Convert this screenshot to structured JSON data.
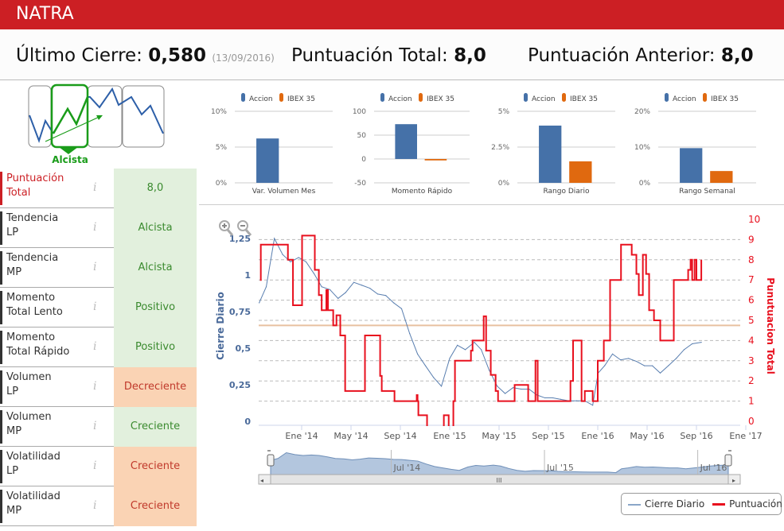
{
  "header": {
    "title": "NATRA"
  },
  "scores": {
    "last_close_label": "Último Cierre:",
    "last_close_value": "0,580",
    "last_close_date": "(13/09/2016)",
    "total_label": "Puntuación Total:",
    "total_value": "8,0",
    "previous_label": "Puntuación Anterior:",
    "previous_value": "8,0"
  },
  "trend_badge": {
    "label": "Alcista",
    "color": "#1a9c1a"
  },
  "indicators": [
    {
      "label1": "Puntuación",
      "label2": "Total",
      "value": "8,0",
      "status": "positive",
      "highlight": true
    },
    {
      "label1": "Tendencia",
      "label2": "LP",
      "value": "Alcista",
      "status": "positive"
    },
    {
      "label1": "Tendencia",
      "label2": "MP",
      "value": "Alcista",
      "status": "positive"
    },
    {
      "label1": "Momento",
      "label2": "Total Lento",
      "value": "Positivo",
      "status": "positive"
    },
    {
      "label1": "Momento",
      "label2": "Total Rápido",
      "value": "Positivo",
      "status": "positive"
    },
    {
      "label1": "Volumen",
      "label2": "LP",
      "value": "Decreciente",
      "status": "negative"
    },
    {
      "label1": "Volumen",
      "label2": "MP",
      "value": "Creciente",
      "status": "positive"
    },
    {
      "label1": "Volatilidad",
      "label2": "LP",
      "value": "Creciente",
      "status": "negative"
    },
    {
      "label1": "Volatilidad",
      "label2": "MP",
      "value": "Creciente",
      "status": "negative"
    }
  ],
  "info_icon": "i",
  "colors": {
    "brand": "#cc1f24",
    "accion": "#4571a8",
    "ibex": "#e0690f",
    "close": "#5a7fb0",
    "score": "#e8101e",
    "threshold": "#e8c1a0"
  },
  "chart_data": [
    {
      "type": "bar",
      "title": "",
      "xlabel": "Var. Volumen Mes",
      "categories": [
        "Accion",
        "IBEX 35"
      ],
      "values": [
        6.2,
        0
      ],
      "ylim": [
        0,
        10
      ],
      "yticks": [
        "10%",
        "5%",
        "0%"
      ],
      "tickvals": [
        10,
        5,
        0
      ],
      "legend": [
        "Accion",
        "IBEX 35"
      ],
      "legend_position": "top"
    },
    {
      "type": "bar",
      "title": "",
      "xlabel": "Momento Rápido",
      "categories": [
        "Accion",
        "IBEX 35"
      ],
      "values": [
        73,
        -3
      ],
      "ylim": [
        -50,
        100
      ],
      "yticks": [
        "100",
        "50",
        "0",
        "-50"
      ],
      "tickvals": [
        100,
        50,
        0,
        -50
      ],
      "legend": [
        "Accion",
        "IBEX 35"
      ],
      "legend_position": "top"
    },
    {
      "type": "bar",
      "title": "",
      "xlabel": "Rango Diario",
      "categories": [
        "Accion",
        "IBEX 35"
      ],
      "values": [
        4.0,
        1.5
      ],
      "ylim": [
        0,
        5
      ],
      "yticks": [
        "5%",
        "2.5%",
        "0%"
      ],
      "tickvals": [
        5,
        2.5,
        0
      ],
      "legend": [
        "Accion",
        "IBEX 35"
      ],
      "legend_position": "top"
    },
    {
      "type": "bar",
      "title": "",
      "xlabel": "Rango Semanal",
      "categories": [
        "Accion",
        "IBEX 35"
      ],
      "values": [
        9.7,
        3.3
      ],
      "ylim": [
        0,
        20
      ],
      "yticks": [
        "20%",
        "10%",
        "0%"
      ],
      "tickvals": [
        20,
        10,
        0
      ],
      "legend": [
        "Accion",
        "IBEX 35"
      ],
      "legend_position": "top"
    },
    {
      "type": "line",
      "ylabel": "Cierre Diario",
      "y2label": "Punutuacion Total",
      "ylim": [
        0,
        1.25
      ],
      "y2lim": [
        0,
        10
      ],
      "grid": true,
      "legend_position": "bottom-right",
      "yticks": [
        "1,25",
        "1",
        "0,75",
        "0,5",
        "0,25",
        "0"
      ],
      "ytickvals": [
        1.25,
        1,
        0.75,
        0.5,
        0.25,
        0
      ],
      "y2ticks": [
        "10",
        "9",
        "8",
        "7",
        "6",
        "5",
        "4",
        "3",
        "2",
        "1",
        "0"
      ],
      "xticks": [
        {
          "label": "Ene '14",
          "date": "2014-01-01"
        },
        {
          "label": "May '14",
          "date": "2014-05-01"
        },
        {
          "label": "Sep '14",
          "date": "2014-09-01"
        },
        {
          "label": "Ene '15",
          "date": "2015-01-01"
        },
        {
          "label": "May '15",
          "date": "2015-05-01"
        },
        {
          "label": "Sep '15",
          "date": "2015-09-01"
        },
        {
          "label": "Ene '16",
          "date": "2016-01-01"
        },
        {
          "label": "May '16",
          "date": "2016-05-01"
        },
        {
          "label": "Sep '16",
          "date": "2016-09-01"
        },
        {
          "label": "Ene '17",
          "date": "2017-01-01"
        }
      ],
      "threshold_y2": 4.75,
      "series": [
        {
          "name": "Cierre Diario",
          "axis": "left",
          "points": [
            [
              "2013-09-18",
              0.81
            ],
            [
              "2013-10-05",
              0.92
            ],
            [
              "2013-10-25",
              1.25
            ],
            [
              "2013-11-15",
              1.14
            ],
            [
              "2013-12-04",
              1.09
            ],
            [
              "2013-12-24",
              1.12
            ],
            [
              "2014-01-12",
              1.09
            ],
            [
              "2014-02-01",
              1.01
            ],
            [
              "2014-02-20",
              0.92
            ],
            [
              "2014-03-10",
              0.9
            ],
            [
              "2014-03-30",
              0.84
            ],
            [
              "2014-04-18",
              0.88
            ],
            [
              "2014-05-08",
              0.95
            ],
            [
              "2014-05-28",
              0.93
            ],
            [
              "2014-06-17",
              0.91
            ],
            [
              "2014-07-06",
              0.87
            ],
            [
              "2014-07-26",
              0.86
            ],
            [
              "2014-08-15",
              0.81
            ],
            [
              "2014-09-04",
              0.77
            ],
            [
              "2014-09-24",
              0.6
            ],
            [
              "2014-10-13",
              0.46
            ],
            [
              "2014-11-02",
              0.38
            ],
            [
              "2014-11-22",
              0.3
            ],
            [
              "2014-12-11",
              0.24
            ],
            [
              "2015-01-01",
              0.43
            ],
            [
              "2015-01-20",
              0.52
            ],
            [
              "2015-02-09",
              0.49
            ],
            [
              "2015-03-01",
              0.54
            ],
            [
              "2015-03-18",
              0.49
            ],
            [
              "2015-04-07",
              0.35
            ],
            [
              "2015-04-27",
              0.24
            ],
            [
              "2015-05-16",
              0.19
            ],
            [
              "2015-06-05",
              0.23
            ],
            [
              "2015-06-25",
              0.22
            ],
            [
              "2015-07-14",
              0.22
            ],
            [
              "2015-08-03",
              0.18
            ],
            [
              "2015-08-23",
              0.16
            ],
            [
              "2015-09-12",
              0.16
            ],
            [
              "2015-10-01",
              0.15
            ],
            [
              "2015-10-21",
              0.14
            ],
            [
              "2015-11-10",
              0.14
            ],
            [
              "2015-11-30",
              0.14
            ],
            [
              "2015-12-19",
              0.11
            ],
            [
              "2016-01-02",
              0.33
            ],
            [
              "2016-01-18",
              0.38
            ],
            [
              "2016-02-07",
              0.46
            ],
            [
              "2016-02-27",
              0.42
            ],
            [
              "2016-03-16",
              0.43
            ],
            [
              "2016-04-05",
              0.41
            ],
            [
              "2016-04-25",
              0.38
            ],
            [
              "2016-05-14",
              0.38
            ],
            [
              "2016-06-03",
              0.33
            ],
            [
              "2016-06-23",
              0.38
            ],
            [
              "2016-07-12",
              0.43
            ],
            [
              "2016-08-01",
              0.49
            ],
            [
              "2016-08-21",
              0.53
            ],
            [
              "2016-09-13",
              0.54
            ]
          ]
        },
        {
          "name": "Puntuación",
          "axis": "right",
          "step": true,
          "points": [
            [
              "2013-09-20",
              7
            ],
            [
              "2013-09-22",
              8.75
            ],
            [
              "2013-11-28",
              8
            ],
            [
              "2013-12-10",
              5.75
            ],
            [
              "2014-01-02",
              9.2
            ],
            [
              "2014-02-03",
              7.5
            ],
            [
              "2014-02-13",
              6.25
            ],
            [
              "2014-02-20",
              5.5
            ],
            [
              "2014-03-01",
              6.5
            ],
            [
              "2014-03-05",
              5.5
            ],
            [
              "2014-03-18",
              4.75
            ],
            [
              "2014-03-26",
              5.25
            ],
            [
              "2014-04-05",
              4.25
            ],
            [
              "2014-04-17",
              1.5
            ],
            [
              "2014-06-05",
              4.25
            ],
            [
              "2014-07-12",
              2.25
            ],
            [
              "2014-07-16",
              1.5
            ],
            [
              "2014-08-17",
              1
            ],
            [
              "2014-10-11",
              1.3
            ],
            [
              "2014-10-13",
              1
            ],
            [
              "2014-10-15",
              0.3
            ],
            [
              "2014-11-06",
              -0.5
            ],
            [
              "2014-12-17",
              0.3
            ],
            [
              "2014-12-29",
              -0.5
            ],
            [
              "2015-01-10",
              1
            ],
            [
              "2015-01-14",
              3
            ],
            [
              "2015-02-23",
              3.5
            ],
            [
              "2015-02-27",
              4
            ],
            [
              "2015-03-24",
              5.2
            ],
            [
              "2015-03-30",
              3.5
            ],
            [
              "2015-04-11",
              2.3
            ],
            [
              "2015-04-23",
              1.5
            ],
            [
              "2015-04-29",
              1
            ],
            [
              "2015-06-09",
              1.8
            ],
            [
              "2015-07-12",
              1
            ],
            [
              "2015-07-30",
              3
            ],
            [
              "2015-08-05",
              1
            ],
            [
              "2015-10-25",
              2
            ],
            [
              "2015-11-01",
              4
            ],
            [
              "2015-11-22",
              1
            ],
            [
              "2015-11-30",
              1.5
            ],
            [
              "2015-12-19",
              1
            ],
            [
              "2016-01-01",
              3
            ],
            [
              "2016-01-16",
              4
            ],
            [
              "2016-02-01",
              7
            ],
            [
              "2016-02-28",
              8.75
            ],
            [
              "2016-03-24",
              8.25
            ],
            [
              "2016-04-05",
              7.3
            ],
            [
              "2016-04-11",
              6.25
            ],
            [
              "2016-04-21",
              8.25
            ],
            [
              "2016-04-29",
              7.3
            ],
            [
              "2016-05-06",
              5.5
            ],
            [
              "2016-05-18",
              5
            ],
            [
              "2016-06-03",
              4
            ],
            [
              "2016-07-06",
              7
            ],
            [
              "2016-08-11",
              7.5
            ],
            [
              "2016-08-17",
              8
            ],
            [
              "2016-08-21",
              7
            ],
            [
              "2016-08-27",
              8
            ],
            [
              "2016-09-01",
              7
            ],
            [
              "2016-09-13",
              8
            ]
          ]
        }
      ]
    }
  ],
  "navigator": {
    "labels": [
      "Jul '14",
      "Jul '15",
      "Jul '16"
    ],
    "label_dates": [
      "2014-07-01",
      "2015-07-01",
      "2016-07-01"
    ],
    "scroll_grip": "III"
  },
  "legend": {
    "items": [
      "Cierre Diario",
      "Puntuación"
    ]
  }
}
